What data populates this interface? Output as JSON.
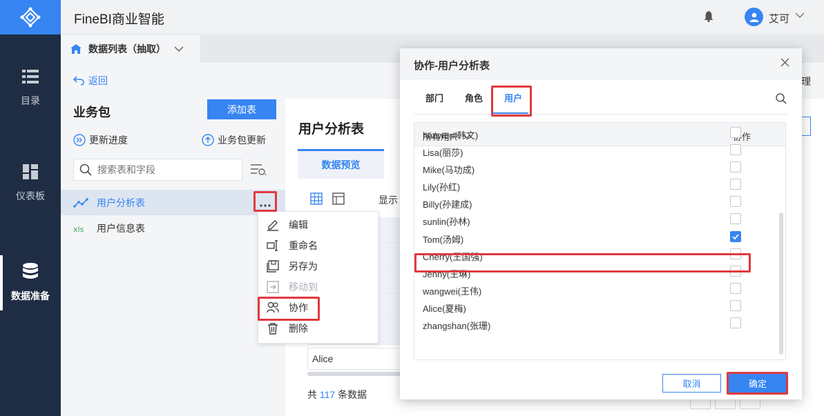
{
  "app": {
    "title": "FineBI商业智能",
    "user": {
      "name": "艾可"
    }
  },
  "sidebar": {
    "items": [
      {
        "label": "目录",
        "icon": "list-icon"
      },
      {
        "label": "仪表板",
        "icon": "dashboard-icon"
      },
      {
        "label": "数据准备",
        "icon": "database-icon",
        "active": true
      }
    ]
  },
  "tabs": {
    "active_label": "数据列表（抽取）"
  },
  "package_panel": {
    "back_label": "返回",
    "title": "业务包",
    "add_table_button": "添加表",
    "update_progress": "更新进度",
    "package_update": "业务包更新",
    "search_placeholder": "搜索表和字段",
    "tables": [
      {
        "label": "用户分析表",
        "icon": "line-chart-icon",
        "selected": true
      },
      {
        "label": "用户信息表",
        "icon": "xls-icon",
        "selected": false
      }
    ]
  },
  "context_menu": {
    "items": [
      {
        "label": "编辑",
        "icon": "edit-icon"
      },
      {
        "label": "重命名",
        "icon": "rename-icon"
      },
      {
        "label": "另存为",
        "icon": "save-as-icon"
      },
      {
        "label": "移动到",
        "icon": "move-icon",
        "disabled": true
      },
      {
        "label": "协作",
        "icon": "collaborate-icon"
      },
      {
        "label": "删除",
        "icon": "trash-icon"
      }
    ]
  },
  "content": {
    "title": "用户分析表",
    "tab_label": "数据预览",
    "show_label": "显示",
    "cell_value": "Alice",
    "total_prefix": "共",
    "total_count": "117",
    "total_suffix": "条数据"
  },
  "right_edge_fragment": "理",
  "dialog": {
    "title": "协作-用户分析表",
    "tabs": [
      "部门",
      "角色",
      "用户"
    ],
    "active_tab": "用户",
    "column_all_users": "所有用户",
    "column_collab": "协作",
    "users": [
      {
        "name": "hanwen(韩文)",
        "checked": false
      },
      {
        "name": "Lisa(丽莎)",
        "checked": false
      },
      {
        "name": "Mike(马功成)",
        "checked": false
      },
      {
        "name": "Lily(孙红)",
        "checked": false
      },
      {
        "name": "Billy(孙建成)",
        "checked": false
      },
      {
        "name": "sunlin(孙林)",
        "checked": false
      },
      {
        "name": "Tom(汤姆)",
        "checked": true
      },
      {
        "name": "Cherry(王国强)",
        "checked": false
      },
      {
        "name": "Jenny(王琳)",
        "checked": false
      },
      {
        "name": "wangwei(王伟)",
        "checked": false
      },
      {
        "name": "Alice(夏梅)",
        "checked": false
      },
      {
        "name": "zhangshan(张珊)",
        "checked": false
      }
    ],
    "cancel_label": "取消",
    "confirm_label": "确定"
  },
  "colors": {
    "accent": "#3685f2",
    "sidebar_bg": "#1f2d44",
    "highlight_red": "#e0393e"
  }
}
